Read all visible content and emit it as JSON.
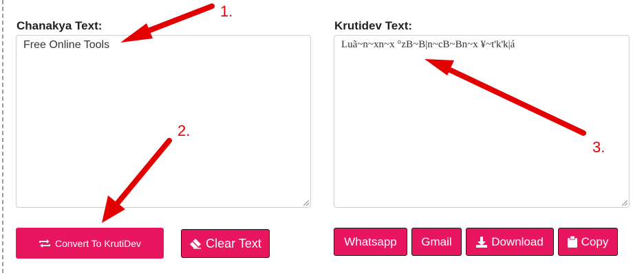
{
  "left_panel": {
    "label": "Chanakya Text:",
    "input_value": "Free Online Tools"
  },
  "right_panel": {
    "label": "Krutidev Text:",
    "output_value": "Luã~n~xn~x °zB~B|n~cB~Bn~x ¥~t'k'k|á"
  },
  "buttons": {
    "convert": "Convert To KrutiDev",
    "clear": "Clear Text",
    "whatsapp": "Whatsapp",
    "gmail": "Gmail",
    "download": "Download",
    "copy": "Copy"
  },
  "annotations": [
    "1.",
    "2.",
    "3."
  ],
  "colors": {
    "accent": "#e8165f",
    "annotation": "#e30000"
  },
  "icons": {
    "convert": "repeat-icon",
    "clear": "eraser-icon",
    "download": "download-icon",
    "copy": "clipboard-icon"
  }
}
